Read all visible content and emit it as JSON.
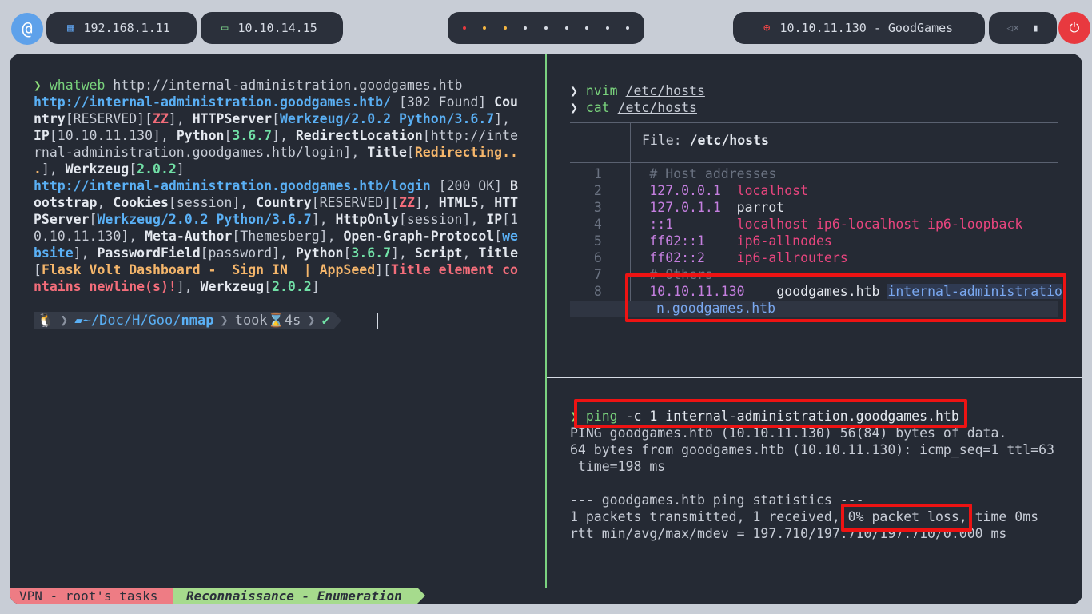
{
  "topbar": {
    "logo_icon": "debian-swirl-icon",
    "ip_local": "192.168.1.11",
    "ip_vpn": "10.10.14.15",
    "target": "10.10.11.130 - GoodGames",
    "workspace_count": 9,
    "active_workspace": 1
  },
  "left_pane": {
    "prompt_cmd": "whatweb",
    "prompt_arg": " http://internal-administration.goodgames.htb",
    "out": [
      {
        "u1": "http://internal-administration.goodgames.htb/",
        "t1": " [302 Found] ",
        "k1": "Cou"
      },
      {
        "k1": "ntry",
        "t1": "[RESERVED][",
        "r1": "ZZ",
        "t2": "], ",
        "k2": "HTTPServer",
        "t3": "[",
        "bl1": "Werkzeug/2.0.2 Python/3.6.7",
        "t4": "],"
      },
      {
        "k1": "IP",
        "t1": "[10.10.11.130], ",
        "k2": "Python",
        "t2": "[",
        "g1": "3.6.7",
        "t3": "], ",
        "k3": "RedirectLocation",
        "t4": "[http://inte"
      },
      {
        "t1": "rnal-administration.goodgames.htb/login], ",
        "k1": "Title",
        "t2": "[",
        "o1": "Redirecting.."
      },
      {
        "o1": ".",
        "t1": "], ",
        "k1": "Werkzeug",
        "t2": "[",
        "g1": "2.0.2",
        "t3": "]"
      },
      {
        "u1": "http://internal-administration.goodgames.htb/login",
        "t1": " [200 OK] ",
        "k1": "B"
      },
      {
        "k1": "ootstrap",
        "t1": ", ",
        "k2": "Cookies",
        "t2": "[session], ",
        "k3": "Country",
        "t3": "[RESERVED][",
        "r1": "ZZ",
        "t4": "], ",
        "k4": "HTML5",
        "t5": ", ",
        "k5": "HTT"
      },
      {
        "k1": "PServer",
        "t1": "[",
        "bl1": "Werkzeug/2.0.2 Python/3.6.7",
        "t2": "], ",
        "k2": "HttpOnly",
        "t3": "[session], ",
        "k3": "IP",
        "t4": "[1"
      },
      {
        "t1": "0.10.11.130], ",
        "k1": "Meta-Author",
        "t2": "[Themesberg], ",
        "k2": "Open-Graph-Protocol",
        "t3": "[",
        "bl1": "we"
      },
      {
        "bl1": "bsite",
        "t1": "], ",
        "k1": "PasswordField",
        "t2": "[password], ",
        "k2": "Python",
        "t3": "[",
        "g1": "3.6.7",
        "t4": "], ",
        "k3": "Script",
        "t5": ", ",
        "k4": "Title"
      },
      {
        "t1": "[",
        "o1": "Flask Volt Dashboard -  Sign IN  | AppSeed",
        "t2": "][",
        "r1": "Title element co"
      },
      {
        "r1": "ntains newline(s)!",
        "t1": "], ",
        "k1": "Werkzeug",
        "t2": "[",
        "g1": "2.0.2",
        "t3": "]"
      }
    ],
    "prompt_bar": {
      "os_icon": "linux-tux-icon",
      "folder_icon": "folder-open-icon",
      "path_prefix": "~/Doc/H/Goo/",
      "path_current": "nmap",
      "took_label": "took",
      "hourglass_icon": "hourglass-icon",
      "duration": "4s",
      "status": "✔"
    }
  },
  "right_top": {
    "cmd1": "nvim",
    "cmd1_arg": "/etc/hosts",
    "cmd2": "cat",
    "cmd2_arg": "/etc/hosts",
    "file_label": "File: ",
    "file_name": "/etc/hosts",
    "rows": [
      {
        "n": "1",
        "a": "# Host addresses",
        "b": ""
      },
      {
        "n": "2",
        "a": "127.0.0.1",
        "b": "  localhost"
      },
      {
        "n": "3",
        "a": "127.0.1.1",
        "b": "  parrot"
      },
      {
        "n": "4",
        "a": "::1",
        "b": "        localhost ip6-localhost ip6-loopback"
      },
      {
        "n": "5",
        "a": "ff02::1",
        "b": "    ip6-allnodes"
      },
      {
        "n": "6",
        "a": "ff02::2",
        "b": "    ip6-allrouters"
      },
      {
        "n": "7",
        "a": "# Others",
        "b": ""
      }
    ],
    "row8": {
      "n": "8",
      "ip": "10.10.11.130",
      "host": "goodgames.htb",
      "sub1": "internal-administratio",
      "sub2": "n.goodgames.htb"
    }
  },
  "right_bottom": {
    "cmd": "ping",
    "args": " -c 1 internal-administration.goodgames.htb",
    "out": [
      "PING goodgames.htb (10.10.11.130) 56(84) bytes of data.",
      "64 bytes from goodgames.htb (10.10.11.130): icmp_seq=1 ttl=63",
      " time=198 ms",
      "",
      "--- goodgames.htb ping statistics ---",
      "1 packets transmitted, 1 received, 0% packet loss, time 0ms",
      "rtt min/avg/max/mdev = 197.710/197.710/197.710/0.000 ms"
    ]
  },
  "statusbar": {
    "session": "VPN - root's tasks",
    "window": "Reconnaissance - Enumeration"
  }
}
